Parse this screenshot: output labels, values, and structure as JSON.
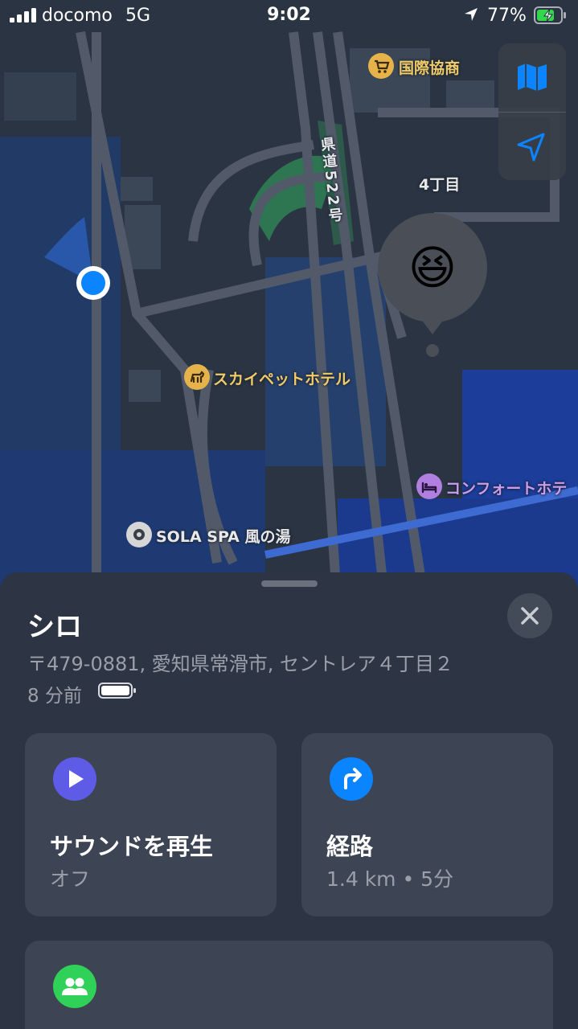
{
  "status_bar": {
    "carrier": "docomo",
    "network": "5G",
    "time": "9:02",
    "battery_percent": "77%"
  },
  "map": {
    "labels": {
      "store": "国際協商",
      "district": "4丁目",
      "road": "県道522号",
      "pet_hotel": "スカイペットホテル",
      "hotel": "コンフォートホテ",
      "spa": "SOLA SPA 風の湯"
    },
    "friend_emoji": "😆",
    "icons": {
      "map_mode": "map-icon",
      "track": "location-arrow-icon",
      "store": "cart-icon",
      "pet": "dog-icon",
      "hotel": "bed-icon",
      "spa": "dot-icon"
    }
  },
  "sheet": {
    "name": "シロ",
    "address": "〒479-0881, 愛知県常滑市, セントレア４丁目２",
    "time_ago": "8 分前",
    "cards": [
      {
        "title": "サウンドを再生",
        "subtitle": "オフ",
        "icon": "play-icon",
        "color": "#5e5ce6"
      },
      {
        "title": "経路",
        "subtitle": "1.4 km • 5分",
        "icon": "turn-right-icon",
        "color": "#0a84ff"
      },
      {
        "title": "",
        "subtitle": "",
        "icon": "people-icon",
        "color": "#30d158"
      }
    ]
  },
  "colors": {
    "map_background": "#2b3442",
    "water": "#1e3f8a",
    "road": "#4c5464",
    "greenery": "#2e7552",
    "user_location": "#0a84ff"
  }
}
